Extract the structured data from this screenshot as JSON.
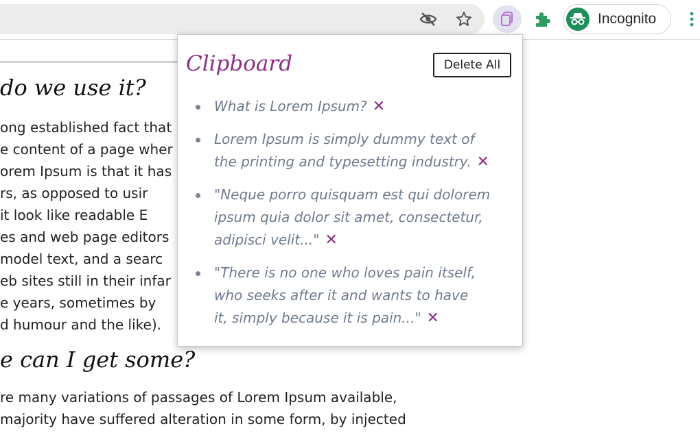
{
  "browser": {
    "profile_label": "Incognito",
    "icons": {
      "tracking": "eye-off-icon",
      "bookmark": "star-icon",
      "clipboard_extension": "clipboard-icon",
      "extensions": "puzzle-icon",
      "incognito": "incognito-icon",
      "menu": "kebab-menu-icon"
    }
  },
  "article": {
    "heading_1": "do we use it?",
    "paragraph_1": [
      "ong established fact that",
      "e content of a page wher",
      "orem Ipsum is that it has",
      "rs,  as  opposed  to  usir",
      " it  look  like  readable  E",
      "es and web page editors",
      " model text, and a searc",
      "eb sites still in their infar",
      "e  years,  sometimes  by",
      "d humour and the like)."
    ],
    "heading_2": "e can I get some?",
    "paragraph_2": [
      "re many variations of passages of Lorem Ipsum available,",
      " majority have suffered alteration in some form, by injected"
    ]
  },
  "popup": {
    "title": "Clipboard",
    "delete_all_label": "Delete All",
    "remove_glyph": "✕",
    "accent_color": "#8a2f86",
    "items": [
      {
        "lines": [
          "What is Lorem Ipsum?"
        ]
      },
      {
        "lines": [
          "Lorem Ipsum is simply dummy text of",
          "the printing and typesetting industry."
        ]
      },
      {
        "lines": [
          "\"Neque porro quisquam est qui dolorem",
          "ipsum quia dolor sit amet, consectetur,",
          "adipisci velit...\""
        ]
      },
      {
        "lines": [
          "\"There is no one who loves pain itself,",
          "who seeks after it and wants to have",
          "it, simply because it is pain...\""
        ]
      }
    ]
  }
}
